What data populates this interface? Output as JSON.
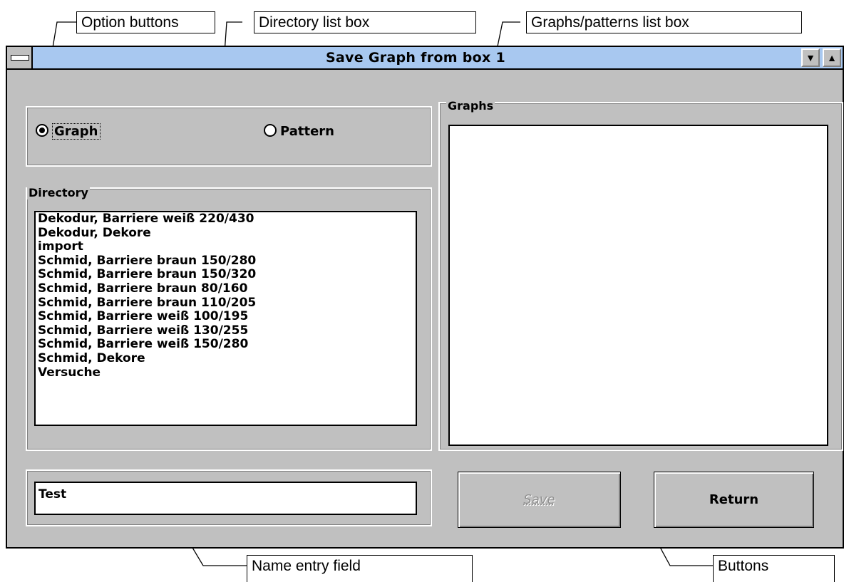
{
  "annotations": {
    "option_buttons": "Option buttons",
    "directory_list_box": "Directory list box",
    "graphs_patterns_list_box": "Graphs/patterns list box",
    "name_entry_field": "Name entry field",
    "buttons": "Buttons"
  },
  "window": {
    "title": "Save  Graph  from box 1",
    "minimize_icon": "down-arrow-icon",
    "maximize_icon": "up-arrow-icon"
  },
  "options": {
    "graph_label": "Graph",
    "pattern_label": "Pattern",
    "selected": "Graph"
  },
  "directory": {
    "label": "Directory",
    "items": [
      "Dekodur, Barriere weiß  220/430",
      "Dekodur, Dekore",
      "import",
      "Schmid, Barriere braun  150/280",
      "Schmid, Barriere braun  150/320",
      "Schmid, Barriere braun  80/160",
      "Schmid, Barriere braun 110/205",
      "Schmid, Barriere weiß  100/195",
      "Schmid, Barriere weiß 130/255",
      "Schmid, Barriere weiß 150/280",
      "Schmid, Dekore",
      "Versuche"
    ]
  },
  "graphs": {
    "label": "Graphs",
    "items": []
  },
  "name_field": {
    "value": "Test"
  },
  "buttons": {
    "save_label": "Save",
    "return_label": "Return"
  }
}
